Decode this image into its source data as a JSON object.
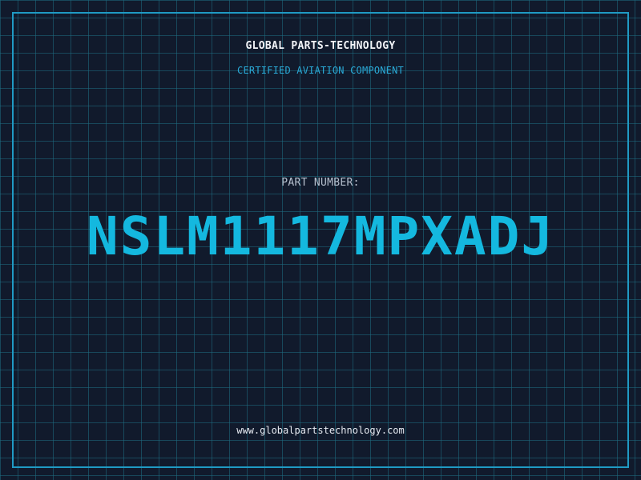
{
  "header": {
    "company": "GLOBAL PARTS-TECHNOLOGY",
    "subtitle": "CERTIFIED AVIATION COMPONENT"
  },
  "part": {
    "label": "PART NUMBER:",
    "number": "NSLM1117MPXADJ"
  },
  "footer": {
    "website": "www.globalpartstechnology.com"
  },
  "colors": {
    "background": "#111a2c",
    "grid": "#1e6e82",
    "frame": "#1f9ac4",
    "accent": "#14b8df",
    "text": "#f2f4f8"
  }
}
